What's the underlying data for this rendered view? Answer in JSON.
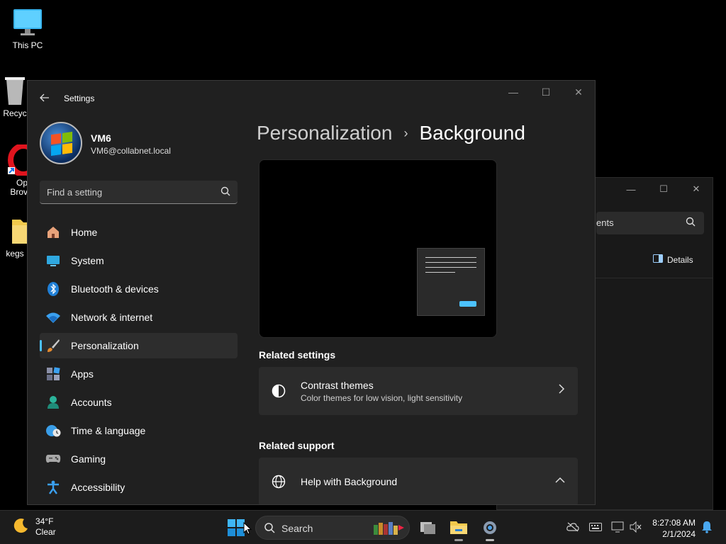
{
  "desktop": {
    "icons": [
      {
        "label": "This PC",
        "icon": "monitor-icon"
      },
      {
        "label": "Recyc",
        "icon": "recycle-bin-icon"
      },
      {
        "label": "Op Brov",
        "icon": "opera-browser-icon"
      },
      {
        "label": "kegs",
        "icon": "folder-icon"
      }
    ]
  },
  "explorer": {
    "search_text": "ents",
    "details_label": "Details"
  },
  "settings": {
    "app_title": "Settings",
    "user": {
      "name": "VM6",
      "email": "VM6@collabnet.local"
    },
    "find_placeholder": "Find a setting",
    "nav": [
      {
        "label": "Home",
        "icon": "home-icon"
      },
      {
        "label": "System",
        "icon": "system-icon"
      },
      {
        "label": "Bluetooth & devices",
        "icon": "bluetooth-icon"
      },
      {
        "label": "Network & internet",
        "icon": "wifi-icon"
      },
      {
        "label": "Personalization",
        "icon": "brush-icon",
        "active": true
      },
      {
        "label": "Apps",
        "icon": "apps-icon"
      },
      {
        "label": "Accounts",
        "icon": "accounts-icon"
      },
      {
        "label": "Time & language",
        "icon": "globe-clock-icon"
      },
      {
        "label": "Gaming",
        "icon": "gamepad-icon"
      },
      {
        "label": "Accessibility",
        "icon": "accessibility-icon"
      }
    ],
    "breadcrumb": {
      "parent": "Personalization",
      "separator": "›",
      "current": "Background"
    },
    "related_settings_heading": "Related settings",
    "contrast_card": {
      "title": "Contrast themes",
      "subtitle": "Color themes for low vision, light sensitivity",
      "icon": "contrast-icon"
    },
    "related_support_heading": "Related support",
    "help_card": {
      "title": "Help with Background",
      "icon": "globe-icon"
    },
    "accent_color": "#4cc2ff"
  },
  "taskbar": {
    "weather": {
      "temp": "34°F",
      "condition": "Clear",
      "icon": "moon-icon"
    },
    "search_label": "Search",
    "apps": [
      "windows-start-icon",
      "task-view-icon",
      "file-explorer-icon",
      "settings-gear-icon"
    ],
    "tray_icons": [
      "cloud-off-icon",
      "keyboard-icon",
      "network-icon",
      "volume-muted-icon",
      "notification-bell-icon"
    ],
    "time": "8:27:08 AM",
    "date": "2/1/2024"
  }
}
